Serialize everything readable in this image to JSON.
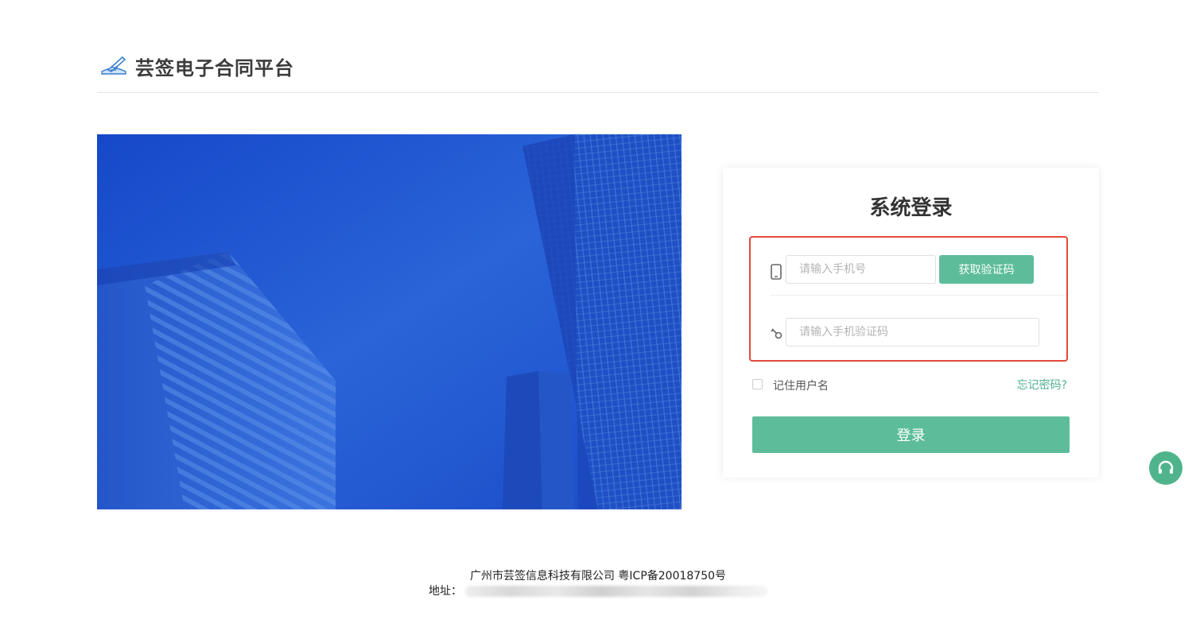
{
  "header": {
    "brand": "芸签电子合同平台",
    "logo_icon": "pen-signature-icon"
  },
  "hero": {
    "image": "skyscrapers-blue-photo"
  },
  "login": {
    "title": "系统登录",
    "phone_placeholder": "请输入手机号",
    "get_code_label": "获取验证码",
    "code_placeholder": "请输入手机验证码",
    "remember_label": "记住用户名",
    "forgot_label": "忘记密码?",
    "submit_label": "登录",
    "icons": {
      "phone": "mobile-phone-icon",
      "code": "key-icon"
    }
  },
  "support": {
    "icon": "headset-icon"
  },
  "footer": {
    "company_line": "广州市芸签信息科技有限公司    粤ICP备20018750号",
    "address_label": "地址："
  },
  "colors": {
    "accent": "#5dbd9a",
    "highlight_border": "#e5473c",
    "hero_blue": "#1f4fd0"
  }
}
